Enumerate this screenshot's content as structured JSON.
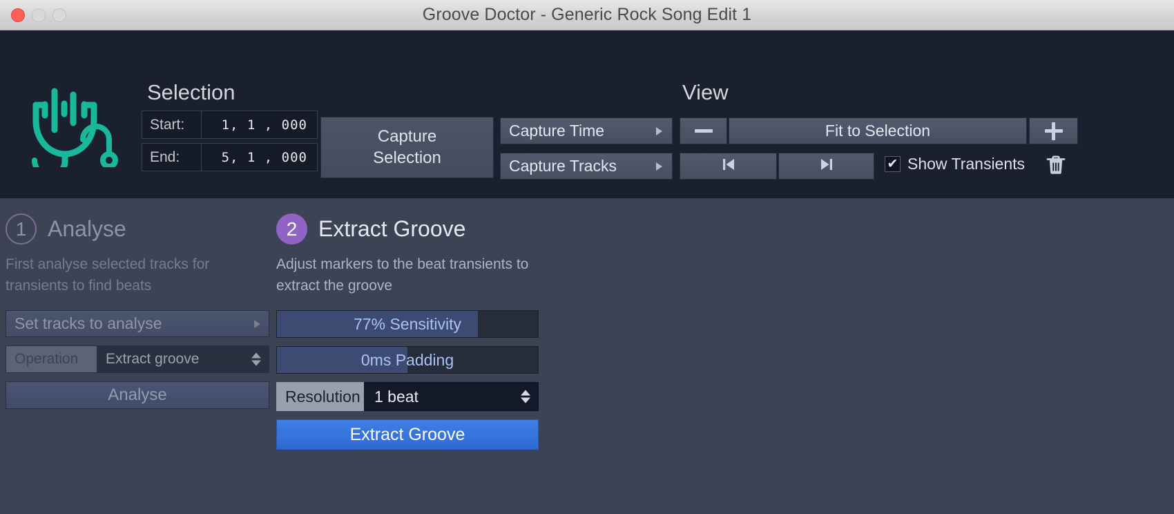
{
  "window": {
    "title": "Groove Doctor - Generic Rock Song Edit 1",
    "traffic_lights": {
      "close": "close",
      "minimize": "minimize",
      "zoom": "zoom"
    }
  },
  "toolbar": {
    "logo_name": "stethoscope-waveform-logo",
    "selection": {
      "title": "Selection",
      "start_label": "Start:",
      "start_value": "1,  1 , 000",
      "end_label": "End:",
      "end_value": "5,  1 , 000",
      "capture_selection_line1": "Capture",
      "capture_selection_line2": "Selection",
      "capture_time": "Capture Time",
      "capture_tracks": "Capture Tracks"
    },
    "view": {
      "title": "View",
      "zoom_out": "minus-icon",
      "zoom_in": "plus-icon",
      "fit_to_selection": "Fit to Selection",
      "prev": "skip-to-start-icon",
      "next": "skip-to-end-icon",
      "show_transients_label": "Show Transients",
      "show_transients_checked": "✔",
      "delete_icon": "trash-icon"
    }
  },
  "panel": {
    "analyse": {
      "step_number": "1",
      "title": "Analyse",
      "description": "First analyse selected tracks for transients to find beats",
      "set_tracks_label": "Set tracks to analyse",
      "operation_label": "Operation",
      "operation_value": "Extract groove",
      "analyse_button": "Analyse"
    },
    "extract": {
      "step_number": "2",
      "title": "Extract Groove",
      "description": "Adjust markers to the beat transients to extract the groove",
      "sensitivity_label": "77% Sensitivity",
      "sensitivity_percent": 77,
      "padding_label": "0ms Padding",
      "padding_percent": 50,
      "resolution_label": "Resolution",
      "resolution_value": "1 beat",
      "extract_button": "Extract Groove"
    }
  },
  "colors": {
    "toolbar_bg": "#1b202e",
    "panel_bg": "#3c4354",
    "logo_teal": "#19b89a",
    "step_purple": "#9063c4",
    "accent_blue": "#3f7fe6",
    "slider_fill": "#3d4a72",
    "slider_text": "#a9c3f5"
  }
}
